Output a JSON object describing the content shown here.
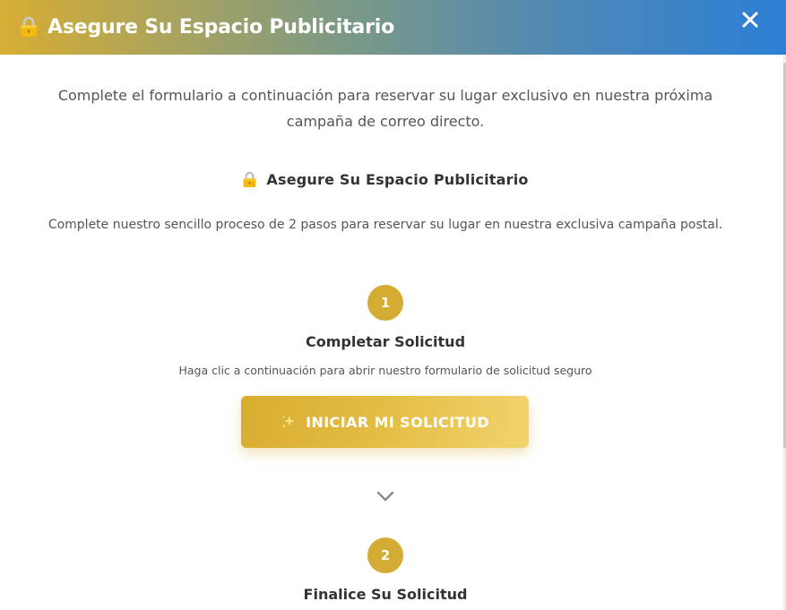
{
  "header": {
    "title": "Asegure Su Espacio Publicitario",
    "close_icon": "close-icon",
    "lock_icon": "lock-icon"
  },
  "intro_text": "Complete el formulario a continuación para reservar su lugar exclusivo en nuestra próxima campaña de correo directo.",
  "section": {
    "heading": "Asegure Su Espacio Publicitario",
    "heading_icon": "lock-icon",
    "subtext": "Complete nuestro sencillo proceso de 2 pasos para reservar su lugar en nuestra exclusiva campaña postal."
  },
  "steps": [
    {
      "number": "1",
      "title": "Completar Solicitud",
      "description": "Haga clic a continuación para abrir nuestro formulario de solicitud seguro",
      "button_label": "INICIAR MI SOLICITUD",
      "button_icon": "sparkle-icon"
    },
    {
      "number": "2",
      "title": "Finalice Su Solicitud"
    }
  ],
  "colors": {
    "accent_gold": "#d4ac33",
    "header_gradient_start": "#d7ad33",
    "header_gradient_end": "#2c7fd6",
    "text": "#555555",
    "heading_text": "#333333"
  }
}
